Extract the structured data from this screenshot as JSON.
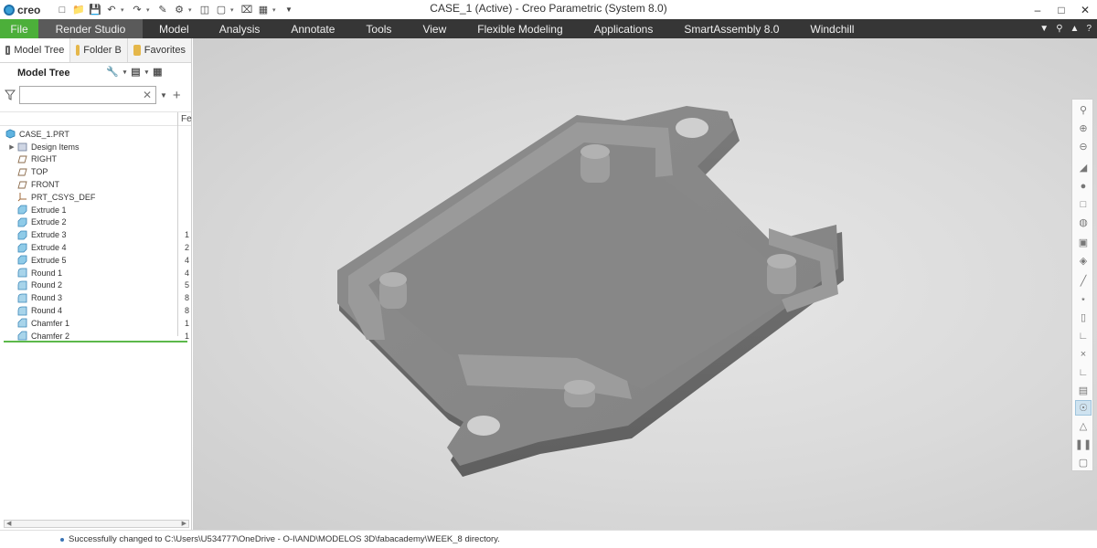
{
  "app": {
    "logo_text": "creo",
    "window_title": "CASE_1 (Active) - Creo Parametric (System 8.0)"
  },
  "quick_access": [
    "new-icon",
    "open-icon",
    "save-icon",
    "undo-icon",
    "redo-icon",
    "regenerate-icon",
    "windows-icon",
    "close-icon",
    "customize-icon"
  ],
  "ribbon": {
    "file_label": "File",
    "active_tab": "Render Studio",
    "tabs": [
      "Model",
      "Analysis",
      "Annotate",
      "Tools",
      "View",
      "Flexible Modeling",
      "Applications",
      "SmartAssembly 8.0",
      "Windchill"
    ]
  },
  "panel": {
    "tabs": [
      "Model Tree",
      "Folder B",
      "Favorites"
    ],
    "tree_title": "Model Tree",
    "search_placeholder": "",
    "column_header": "Fe"
  },
  "tree": [
    {
      "label": "CASE_1.PRT",
      "type": "part",
      "col": ""
    },
    {
      "label": "Design Items",
      "type": "folder",
      "col": ""
    },
    {
      "label": "RIGHT",
      "type": "plane",
      "col": ""
    },
    {
      "label": "TOP",
      "type": "plane",
      "col": ""
    },
    {
      "label": "FRONT",
      "type": "plane",
      "col": ""
    },
    {
      "label": "PRT_CSYS_DEF",
      "type": "csys",
      "col": ""
    },
    {
      "label": "Extrude 1",
      "type": "extrude",
      "col": ""
    },
    {
      "label": "Extrude 2",
      "type": "extrude",
      "col": ""
    },
    {
      "label": "Extrude 3",
      "type": "extrude",
      "col": "1"
    },
    {
      "label": "Extrude 4",
      "type": "extrude",
      "col": "2"
    },
    {
      "label": "Extrude 5",
      "type": "extrude",
      "col": "4"
    },
    {
      "label": "Round 1",
      "type": "round",
      "col": "4"
    },
    {
      "label": "Round 2",
      "type": "round",
      "col": "5"
    },
    {
      "label": "Round 3",
      "type": "round",
      "col": "8"
    },
    {
      "label": "Round 4",
      "type": "round",
      "col": "8"
    },
    {
      "label": "Chamfer 1",
      "type": "chamfer",
      "col": "1"
    },
    {
      "label": "Chamfer 2",
      "type": "chamfer",
      "col": "1"
    }
  ],
  "status": {
    "message": "Successfully changed to C:\\Users\\U534777\\OneDrive - O-I\\AND\\MODELOS 3D\\fabacademy\\WEEK_8 directory."
  },
  "colors": {
    "ribbon_bg": "#363636",
    "file_tab": "#4caf3a",
    "active_tab": "#5a5a5a",
    "model_gray": "#8a8a8a"
  }
}
